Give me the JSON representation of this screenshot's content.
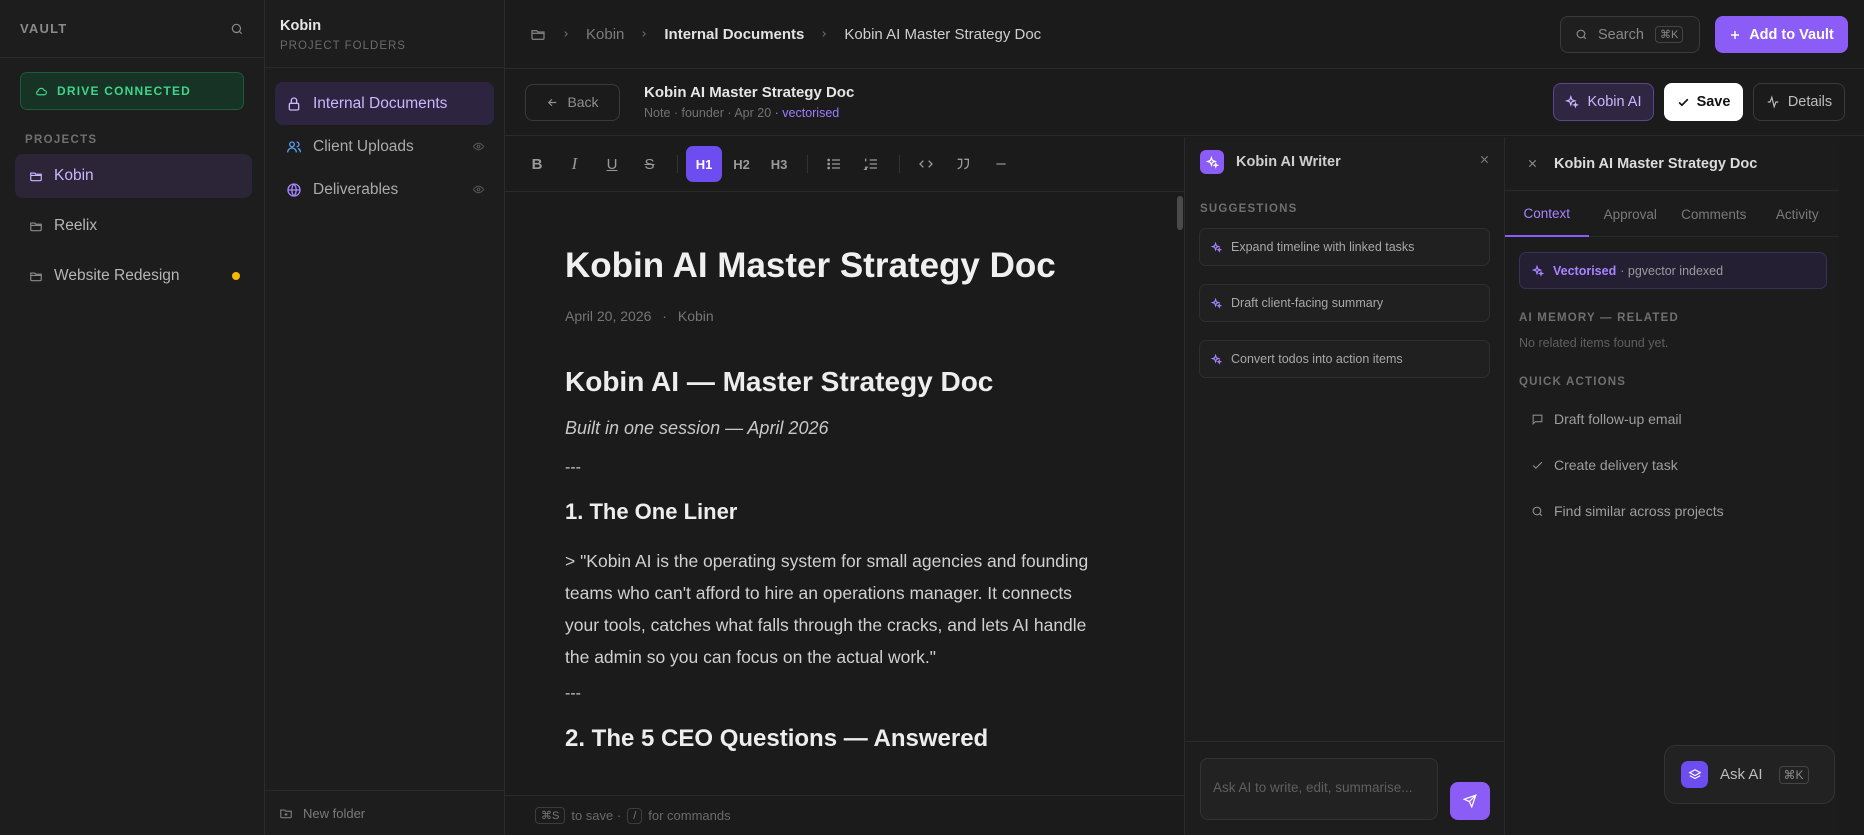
{
  "sidebar": {
    "title": "VAULT",
    "drive_status": "DRIVE CONNECTED",
    "section": "PROJECTS",
    "projects": [
      {
        "name": "Kobin"
      },
      {
        "name": "Reelix"
      },
      {
        "name": "Website Redesign"
      }
    ]
  },
  "folders": {
    "title": "Kobin",
    "subtitle": "PROJECT FOLDERS",
    "items": [
      {
        "name": "Internal Documents"
      },
      {
        "name": "Client Uploads"
      },
      {
        "name": "Deliverables"
      }
    ],
    "new_folder": "New folder"
  },
  "topbar": {
    "breadcrumb": [
      "Kobin",
      "Internal Documents",
      "Kobin AI Master Strategy Doc"
    ],
    "search_label": "Search",
    "search_kbd": "⌘K",
    "add_button": "Add to Vault"
  },
  "docbar": {
    "back": "Back",
    "title": "Kobin AI Master Strategy Doc",
    "meta": "Note · founder · Apr 20",
    "vectorised": " · vectorised",
    "ai_button": "Kobin AI",
    "save_button": "Save",
    "details_button": "Details"
  },
  "toolbar": {
    "bold": "B",
    "italic": "I",
    "underline": "U",
    "strike": "S",
    "h1": "H1",
    "h2": "H2",
    "h3": "H3"
  },
  "document": {
    "title": "Kobin AI Master Strategy Doc",
    "date": "April 20, 2026",
    "author": "Kobin",
    "date_sep": "·",
    "h1": "Kobin AI — Master Strategy Doc",
    "subtitle": "Built in one session — April 2026",
    "rule": "---",
    "section1": "1. The One Liner",
    "quote": "> \"Kobin AI is the operating system for small agencies and founding teams who can't afford to hire an operations manager. It connects your tools, catches what falls through the cracks, and lets AI handle the admin so you can focus on the actual work.\"",
    "section2": "2. The 5 CEO Questions — Answered"
  },
  "statusbar": {
    "save_kbd": "⌘S",
    "save_text": "to save ·",
    "cmd_kbd": "/",
    "cmd_text": "for commands"
  },
  "writer": {
    "title": "Kobin AI Writer",
    "section": "SUGGESTIONS",
    "suggestions": [
      "Expand timeline with linked tasks",
      "Draft client-facing summary",
      "Convert todos into action items"
    ],
    "input_placeholder": "Ask AI to write, edit, summarise..."
  },
  "details": {
    "title": "Kobin AI Master Strategy Doc",
    "tabs": [
      "Context",
      "Approval",
      "Comments",
      "Activity"
    ],
    "vectorised_label": "Vectorised",
    "vectorised_meta": "· pgvector indexed",
    "memory_section": "AI MEMORY — RELATED",
    "memory_empty": "No related items found yet.",
    "actions_section": "QUICK ACTIONS",
    "actions": [
      "Draft follow-up email",
      "Create delivery task",
      "Find similar across projects"
    ]
  },
  "ask_ai": {
    "label": "Ask AI",
    "kbd": "⌘K"
  },
  "colors": {
    "accent": "#8b5cf6",
    "drive_green": "#3fd58a",
    "unread_dot": "#f5b800"
  }
}
